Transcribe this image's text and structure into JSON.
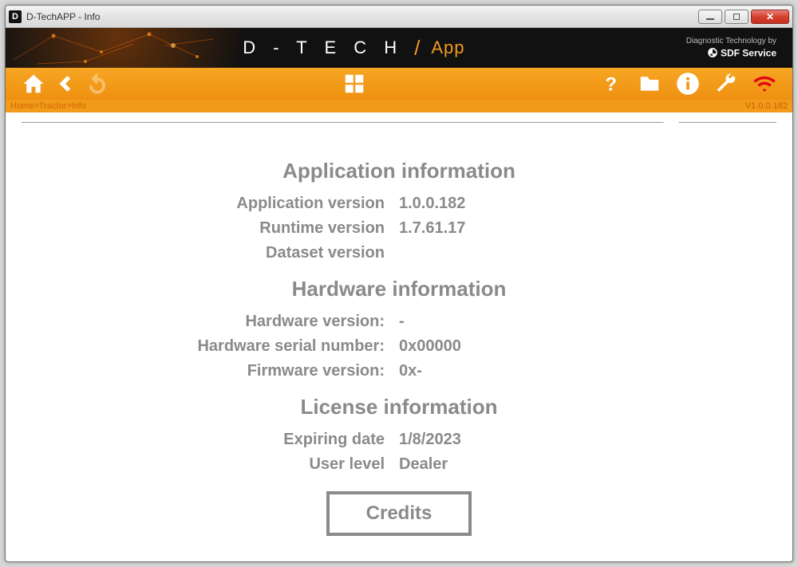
{
  "window": {
    "title": "D-TechAPP - Info"
  },
  "brand": {
    "logo_text": "D - T E C H",
    "app_word": "App",
    "tagline": "Diagnostic Technology by",
    "service": "SDF Service"
  },
  "breadcrumb": "Home>Tractor>Info",
  "version_label": "V1.0.0.182",
  "sections": {
    "app": {
      "title": "Application information",
      "rows": [
        {
          "k": "Application version",
          "v": "1.0.0.182"
        },
        {
          "k": "Runtime version",
          "v": "1.7.61.17"
        },
        {
          "k": "Dataset version",
          "v": ""
        }
      ]
    },
    "hw": {
      "title": "Hardware information",
      "rows": [
        {
          "k": "Hardware version:",
          "v": "-"
        },
        {
          "k": "Hardware serial number:",
          "v": "0x00000"
        },
        {
          "k": "Firmware version:",
          "v": "0x-"
        }
      ]
    },
    "lic": {
      "title": "License information",
      "rows": [
        {
          "k": "Expiring date",
          "v": "1/8/2023"
        },
        {
          "k": "User level",
          "v": "Dealer"
        }
      ]
    }
  },
  "buttons": {
    "credits": "Credits"
  }
}
